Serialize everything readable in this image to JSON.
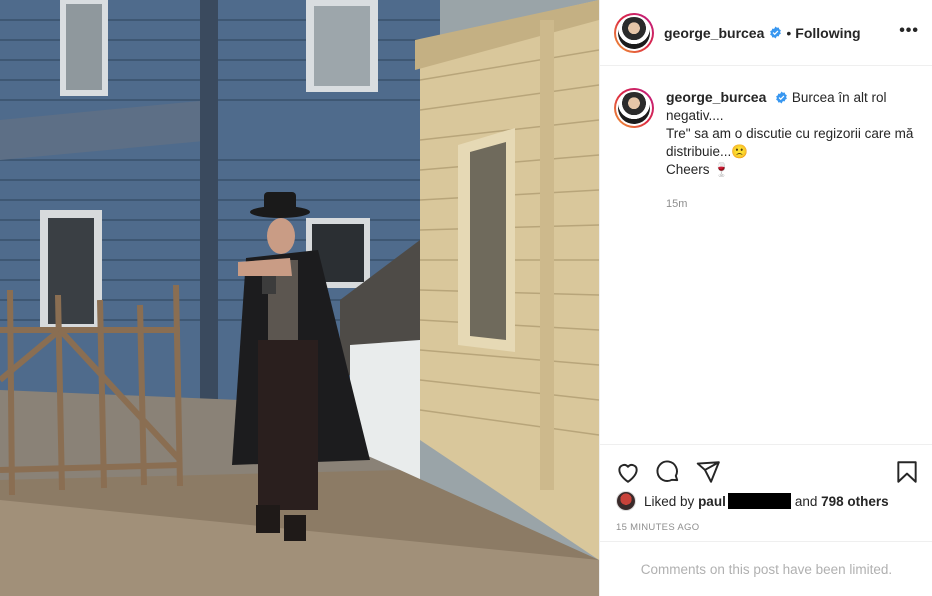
{
  "header": {
    "username": "george_burcea",
    "separator": "•",
    "follow_status": "Following",
    "more_label": "•••"
  },
  "caption": {
    "username": "george_burcea",
    "line1": "Burcea în alt rol negativ....",
    "line2": "Tre\" sa am o discutie cu regizorii care mă distribuie...🙁",
    "line3": "Cheers 🍷"
  },
  "comment_time": "15m",
  "likes": {
    "prefix": "Liked by",
    "first_user": "paul",
    "connector": "and",
    "others": "798 others"
  },
  "posted_time": "15 MINUTES AGO",
  "comments_notice": "Comments on this post have been limited.",
  "icons": {
    "like": "heart-icon",
    "comment": "comment-bubble-icon",
    "share": "paper-plane-icon",
    "save": "bookmark-icon",
    "verified": "verified-badge-icon"
  },
  "colors": {
    "verified_blue": "#3897f0",
    "text": "#262626",
    "muted": "#8e8e8e",
    "border": "#efefef"
  }
}
